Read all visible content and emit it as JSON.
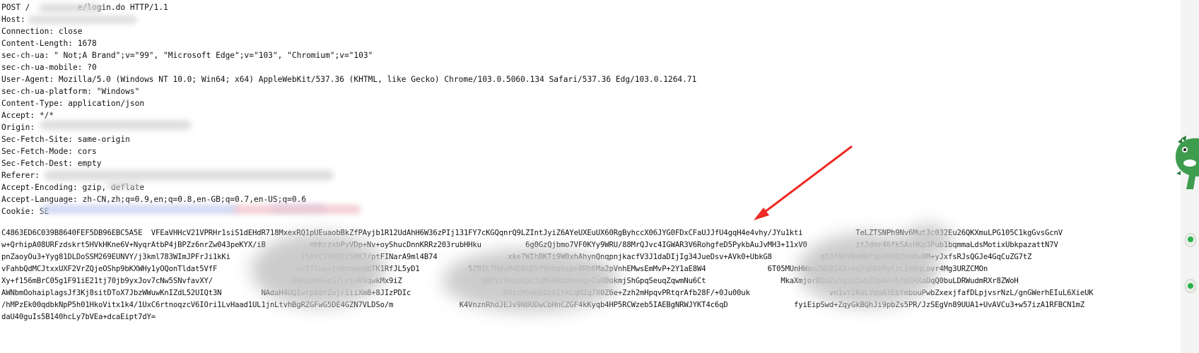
{
  "request": {
    "headers": [
      "POST /          e/login.do HTTP/1.1",
      "Host:",
      "Connection: close",
      "Content-Length: 1678",
      "sec-ch-ua: \" Not;A Brand\";v=\"99\", \"Microsoft Edge\";v=\"103\", \"Chromium\";v=\"103\"",
      "sec-ch-ua-mobile: ?0",
      "User-Agent: Mozilla/5.0 (Windows NT 10.0; Win64; x64) AppleWebKit/537.36 (KHTML, like Gecko) Chrome/103.0.5060.134 Safari/537.36 Edg/103.0.1264.71",
      "sec-ch-ua-platform: \"Windows\"",
      "Content-Type: application/json",
      "Accept: */*",
      "Origin:",
      "Sec-Fetch-Site: same-origin",
      "Sec-Fetch-Mode: cors",
      "Sec-Fetch-Dest: empty",
      "Referer:",
      "Accept-Encoding: gzip, deflate",
      "Accept-Language: zh-CN,zh;q=0.9,en;q=0.8,en-GB;q=0.7,en-US;q=0.6",
      "Cookie: SE"
    ],
    "body_lines": [
      "C4863ED6C039B8640FEF5DB96EBC5A5E  VFEaVHHcV21VPRHr1siS1dEHdR718MxexRQ1pUEuaobBkZfPAyjb1R12UdAhH6W36zPIj131FY7cKGQqnrQ9LZIntJyiZ6AYeUXEuUX60RgByhccX06JYG0FDxCFaUJJfU4gqH4e4vhy/JYu1kti            TeLZTSNPh9Nv6Mut3c032Eu26QKXmuLPG105C1kgGvsGcnV",
      "w+QrhipA08URFzdskrt5HVkHKne6V+NyqrAtbP4jBPZz6nrZw043peKYX/iB          nhKczxbPyVDp+Nv+oyShucDnnKRRz203rubHHku          6g0GzQjbmo7VF0KYy9WRU/88MrQJvc4IGWAR3V6RohgfeD5PykbAuJvMH3+11xV0           itJdmr46fkSAsHKp3Pub1bqmmaLdsMotixUbkpazattN7V",
      "pnZaoyOu3+Yyg81DLDoSSM269EUNVY/j3kml783WImJPFrJi1kKi                75XrCSVUQTz50K7/ptFINarA9ml4B74                xke7WIhBKTi9W0xhAhynQnqpnjkacfV3J1daDIjIg34JueDsv+AVk0+UbkG8           gS3fNDVBmM0fup40M02Vm0v8M+yJxfsRJsQGJe4GqCuZG7tZ",
      "vFahbQdMCJtxxUXF2VrZQjeOShp9bKXWHy1yOQonTldat5VfF                  uxZf7uwvtxBnqmegbTK1RfJL5yD1           5Z0ILTMdyM4D8xEVf9nhphsp+BRh6Ma2pVnhEMwsEmMvP+2Y1aE8W4              6T05MUnHWauZNDB5AX+aq2q6DkMyCzL1m8qLovr4Mg3URZCMOn",
      "Xy+f156mBrC05g1F91iE21tj70jb9yxJov7cNw5SNvfavXY/                  eUnxUd6GcG7Lri+KVqwkMx9iZ                  UQYVzYoouOpC3gMG8Kmdmxoq+ZuH0okmjShGpqSeuqZqwmNu6Ct                 MkaXmjorBQoZuYgJxIwhZ2pAn+hfpEHXoDqQ0buLDRWudmRXr8ZWoH",
      "AWNbmOohaiplagsJf3Kj8sitDToX7JbzWWuwKnIZdL52UIQt3N         NAdaH4UQIwrp80rZojr1iiXm8+8JIzPDIc                     D0itM5mbEOzXitkLqMZq7X0Z6e+Zzh2mHpqvPRtqrAfb28F/+0Ju00uk                  vn1vY2RaLVdoA3EbYmbouPwbZxexjfafDLpjvsrNzL/gnGWerhEIuL6XieUK",
      "/hMPzEk00qdbkNpP5h01HkoVitx1k4/1UxC6rtnoqzcV6IOri1LvHaad1UL1jnLtvhBgRZGFwG5DE4GZN7VLDSo/m               K4VnznRhdJEJv9N0UDwCbHnCZGF4kKyqb4HP5RCWzeb5IAEBgNRWJYKT4c6qD               fyiEipSwd+ZqyGkBQhJi9pbZs5PR/JzSEgVn89UUA1+UvAVCu3+w57izA1RFBCN1mZ",
      "daU40guIs5B140hcLy7bVEa+dcaEipt7dY="
    ]
  },
  "colors": {
    "text": "#111111",
    "arrow": "#ee2a24",
    "mascot": "#3f9d4f"
  },
  "icons": {
    "arrow": "red-arrow-icon",
    "mascot": "dinosaur-mascot-icon"
  }
}
